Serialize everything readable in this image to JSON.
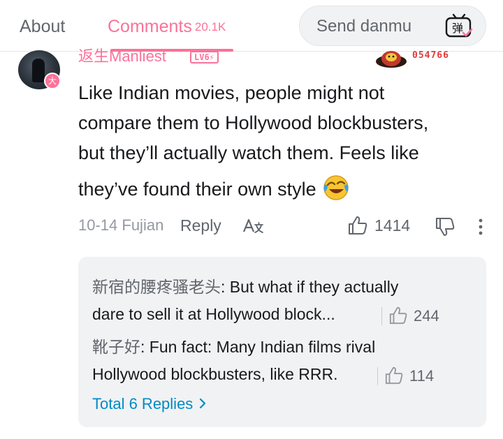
{
  "header": {
    "tab_about": "About",
    "tab_comments": "Comments",
    "comments_count": "20.1K",
    "danmu_placeholder": "Send danmu",
    "danmu_icon": "danmu-toggle-icon"
  },
  "comment": {
    "username": "返生Manliest",
    "level": "LV6⚡",
    "fan_number": "054766",
    "avatar_badge": "大",
    "text_line1": "Like Indian movies, people might not",
    "text_line2": "compare them to Hollywood blockbusters,",
    "text_line3": "but they’ll actually watch them. Feels like",
    "text_line4": "they’ve found their own style",
    "date_location": "10-14 Fujian",
    "reply_label": "Reply",
    "like_count": "1414"
  },
  "replies": {
    "items": [
      {
        "name": "新宿的腰疼骚老头",
        "text_line1": ": But what if they actually",
        "text_line2": "dare to sell it at Hollywood block...",
        "likes": "244"
      },
      {
        "name": "靴子好",
        "text_line1": ": Fun fact: Many Indian films rival",
        "text_line2": "Hollywood blockbusters, like RRR.",
        "likes": "114"
      }
    ],
    "total_label": "Total 6 Replies"
  },
  "colors": {
    "accent": "#fb7299",
    "link": "#008ac5",
    "muted": "#9499a0",
    "text": "#18191c"
  }
}
